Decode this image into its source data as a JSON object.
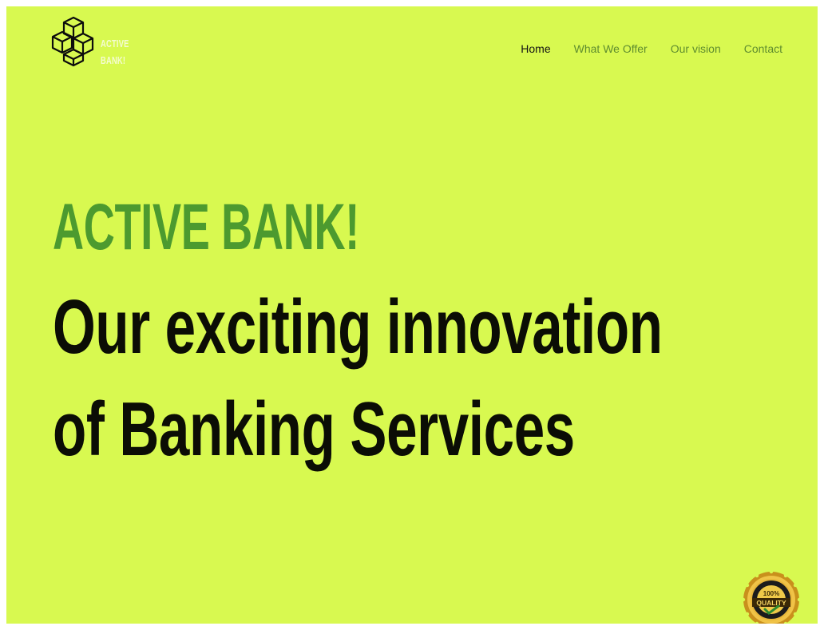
{
  "brand": {
    "logo_text": "ACTIVE\nBANK!",
    "logo_icon": "stacked-cubes-icon"
  },
  "nav": {
    "items": [
      {
        "label": "Home",
        "active": true
      },
      {
        "label": "What We Offer",
        "active": false
      },
      {
        "label": "Our vision",
        "active": false
      },
      {
        "label": "Contact",
        "active": false
      }
    ]
  },
  "hero": {
    "eyebrow": "ACTIVE BANK!",
    "headline_line1": "Our exciting innovation",
    "headline_line2": "of Banking Services"
  },
  "badge": {
    "icon": "quality-seal-icon",
    "top_text": "100%",
    "ribbon_text": "QUALITY"
  },
  "colors": {
    "background": "#d8f950",
    "accent_green": "#4c9a2f",
    "nav_link": "#5f8d2f",
    "nav_active": "#141414",
    "headline": "#0b0d05"
  }
}
